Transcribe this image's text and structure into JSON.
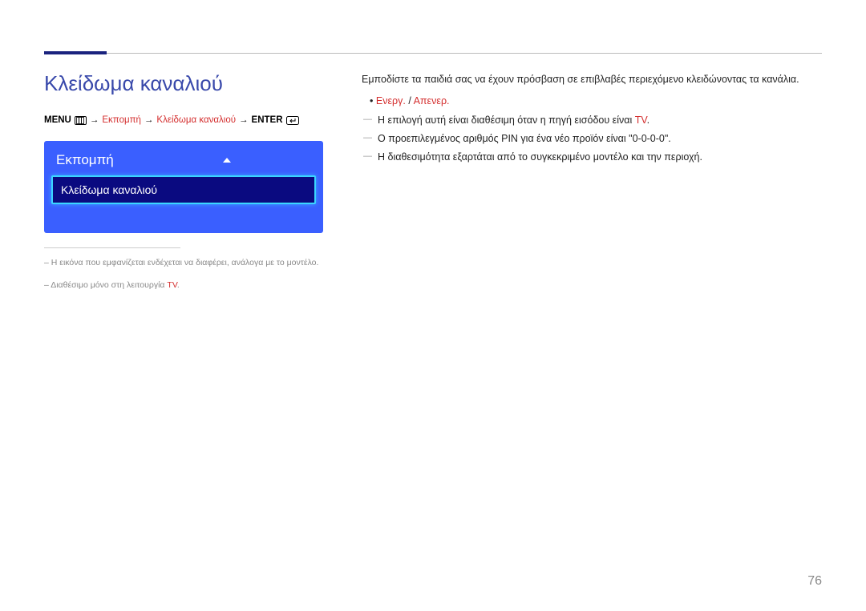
{
  "page": {
    "title": "Κλείδωμα καναλιού",
    "page_number": "76"
  },
  "path": {
    "menu_label": "MENU",
    "seg1": "Εκπομπή",
    "seg2": "Κλείδωμα καναλιού",
    "enter_label": "ENTER"
  },
  "menu_panel": {
    "header": "Εκπομπή",
    "selected_item": "Κλείδωμα καναλιού"
  },
  "footnotes": {
    "n1": "Η εικόνα που εμφανίζεται ενδέχεται να διαφέρει, ανάλογα με το μοντέλο.",
    "n2_prefix": "Διαθέσιμο μόνο στη λειτουργία ",
    "n2_red": "TV",
    "n2_suffix": "."
  },
  "right": {
    "intro": "Εμποδίστε τα παιδιά σας να έχουν πρόσβαση σε επιβλαβές περιεχόμενο κλειδώνοντας τα κανάλια.",
    "bullet_red1": "Ενεργ.",
    "bullet_sep": " / ",
    "bullet_red2": "Απενερ.",
    "note1_prefix": "Η επιλογή αυτή είναι διαθέσιμη όταν η πηγή εισόδου είναι ",
    "note1_red": "TV",
    "note1_suffix": ".",
    "note2": "Ο προεπιλεγμένος αριθμός PIN για ένα νέο προϊόν είναι \"0-0-0-0\".",
    "note3": "Η διαθεσιμότητα εξαρτάται από το συγκεκριμένο μοντέλο και την περιοχή."
  }
}
